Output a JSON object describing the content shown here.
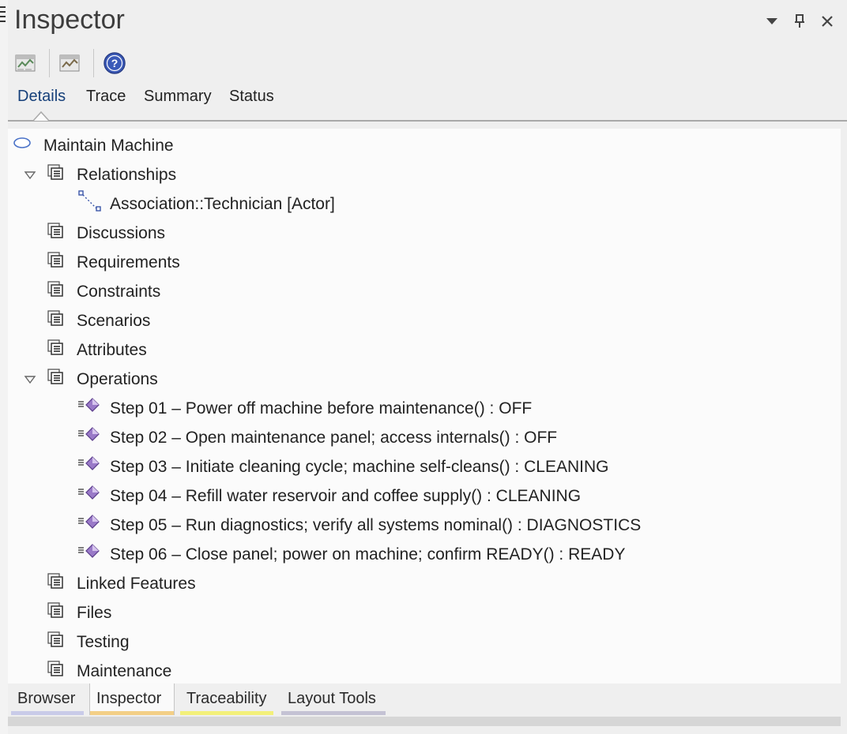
{
  "window": {
    "title": "Inspector"
  },
  "title_buttons": {
    "dropdown_icon": "chevron-down-icon",
    "pin_icon": "pin-icon",
    "close_icon": "close-icon"
  },
  "toolbar": {
    "tools": [
      "properties-icon",
      "element-properties-icon",
      "help-icon"
    ]
  },
  "tabs": [
    {
      "label": "Details",
      "active": true
    },
    {
      "label": "Trace",
      "active": false
    },
    {
      "label": "Summary",
      "active": false
    },
    {
      "label": "Status",
      "active": false
    }
  ],
  "tree": {
    "root": "Maintain Machine",
    "relationships": {
      "label": "Relationships",
      "expanded": true,
      "children": [
        "Association::Technician [Actor]"
      ]
    },
    "discussions": "Discussions",
    "requirements": "Requirements",
    "constraints": "Constraints",
    "scenarios": "Scenarios",
    "attributes": "Attributes",
    "operations": {
      "label": "Operations",
      "expanded": true,
      "children": [
        "Step 01 – Power off machine before maintenance() : OFF",
        "Step 02 – Open maintenance panel; access internals() : OFF",
        "Step 03 – Initiate cleaning cycle; machine self-cleans() : CLEANING",
        "Step 04 – Refill water reservoir and coffee supply() : CLEANING",
        "Step 05 – Run diagnostics; verify all systems nominal() : DIAGNOSTICS",
        "Step 06 – Close panel; power on machine; confirm READY() : READY"
      ]
    },
    "linked_features": "Linked Features",
    "files": "Files",
    "testing": "Testing",
    "maintenance": "Maintenance"
  },
  "bottom_tabs": [
    {
      "label": "Browser",
      "color": "#c9cbe8",
      "active": false
    },
    {
      "label": "Inspector",
      "color": "#f3cf86",
      "active": true
    },
    {
      "label": "Traceability",
      "color": "#f3f07a",
      "active": false
    },
    {
      "label": "Layout Tools",
      "color": "#c4c2d4",
      "active": false
    }
  ]
}
